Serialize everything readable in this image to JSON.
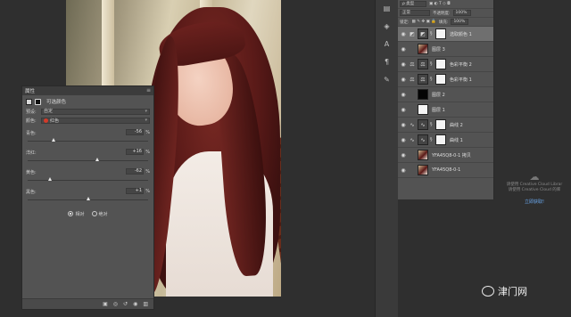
{
  "properties_panel": {
    "title": "属性",
    "menu_icon": "menu-lines-icon",
    "adjustment_name": "可选颜色",
    "preset_label": "预设:",
    "preset_value": "自定",
    "colors_label": "颜色:",
    "colors_value": "红色",
    "colors_swatch": "#d23b2a",
    "sliders": [
      {
        "name": "青色:",
        "value": "-56",
        "unit": "%",
        "level": -0.56
      },
      {
        "name": "洋红:",
        "value": "+16",
        "unit": "%",
        "level": 0.16
      },
      {
        "name": "黄色:",
        "value": "-62",
        "unit": "%",
        "level": -0.62
      },
      {
        "name": "黑色:",
        "value": "+1",
        "unit": "%",
        "level": 0.01
      }
    ],
    "method_relative": "相对",
    "method_absolute": "绝对",
    "method_selected": "relative"
  },
  "layers_panel": {
    "kind_filter": "类型",
    "blend_mode": "正常",
    "opacity_label": "不透明度:",
    "opacity_value": "100%",
    "lock_label": "锁定:",
    "fill_label": "填充:",
    "fill_value": "100%",
    "layers": [
      {
        "name": "选取颜色 1",
        "thumb": "adjt",
        "icon": "selective-color-icon",
        "mask": true,
        "selected": true
      },
      {
        "name": "图层 3",
        "thumb": "photo",
        "mask": false,
        "selected": false
      },
      {
        "name": "色彩平衡 2",
        "thumb": "adjt",
        "icon": "balance-icon",
        "mask": true,
        "selected": false
      },
      {
        "name": "色彩平衡 1",
        "thumb": "adjt",
        "icon": "balance-icon",
        "mask": true,
        "selected": false
      },
      {
        "name": "图层 2",
        "thumb": "black",
        "mask": false,
        "selected": false
      },
      {
        "name": "图层 1",
        "thumb": "white",
        "mask": false,
        "selected": false
      },
      {
        "name": "曲线 2",
        "thumb": "adjt",
        "icon": "curves-icon",
        "mask": true,
        "selected": false
      },
      {
        "name": "曲线 1",
        "thumb": "adjt",
        "icon": "curves-icon",
        "mask": true,
        "selected": false
      },
      {
        "name": "YFA45Q8-0-1 拷贝",
        "thumb": "photo",
        "mask": false,
        "selected": false
      },
      {
        "name": "YFA45Q8-0-1",
        "thumb": "photo",
        "mask": false,
        "selected": false
      }
    ]
  },
  "cloud_panel": {
    "line1": "请使用 Creative Cloud Librar",
    "line2": "请使用 Creative Cloud 的库",
    "link": "立即获取!"
  },
  "watermark": {
    "text": "津门网"
  }
}
